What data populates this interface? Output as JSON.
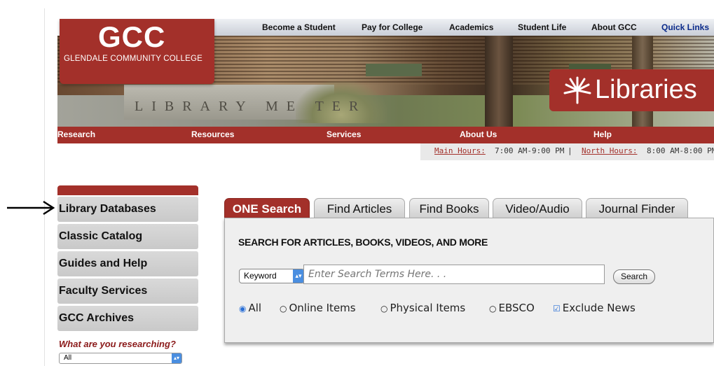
{
  "header": {
    "logo_mark": "GCC",
    "college_name": "GLENDALE COMMUNITY COLLEGE",
    "libraries_label": "Libraries",
    "library_wall_text": "LIBRARY ME  TER"
  },
  "top_nav": [
    "Become a Student",
    "Pay for College",
    "Academics",
    "Student Life",
    "About GCC",
    "Quick Links"
  ],
  "red_nav": [
    "Research",
    "Resources",
    "Services",
    "About Us",
    "Help"
  ],
  "hours": {
    "main_label": "Main Hours:",
    "main_value": "7:00 AM-9:00 PM",
    "separator": "|",
    "north_label": "North Hours:",
    "north_value": "8:00 AM-8:00 PM"
  },
  "sidebar": {
    "items": [
      "Library Databases",
      "Classic Catalog",
      "Guides and Help",
      "Faculty Services",
      "GCC Archives"
    ],
    "research_prompt": "What are you researching?",
    "research_select_value": "All"
  },
  "tabs": [
    "ONE Search",
    "Find Articles",
    "Find Books",
    "Video/Audio",
    "Journal Finder"
  ],
  "search": {
    "heading": "SEARCH FOR ARTICLES, BOOKS, VIDEOS, AND MORE",
    "field_select": "Keyword",
    "placeholder": "Enter Search Terms Here. . .",
    "button_label": "Search",
    "filters": [
      {
        "label": "All",
        "type": "radio",
        "checked": true
      },
      {
        "label": "Online Items",
        "type": "radio",
        "checked": false
      },
      {
        "label": "Physical Items",
        "type": "radio",
        "checked": false
      },
      {
        "label": "EBSCO",
        "type": "radio",
        "checked": false
      },
      {
        "label": "Exclude News",
        "type": "checkbox",
        "checked": true
      }
    ]
  },
  "icons": {
    "arrow": "arrow-right-icon",
    "libraries": "palm-icon",
    "dropdown": "chevron-updown-icon"
  },
  "colors": {
    "brand_red": "#a3302a",
    "accent_blue": "#4a8ee0"
  }
}
